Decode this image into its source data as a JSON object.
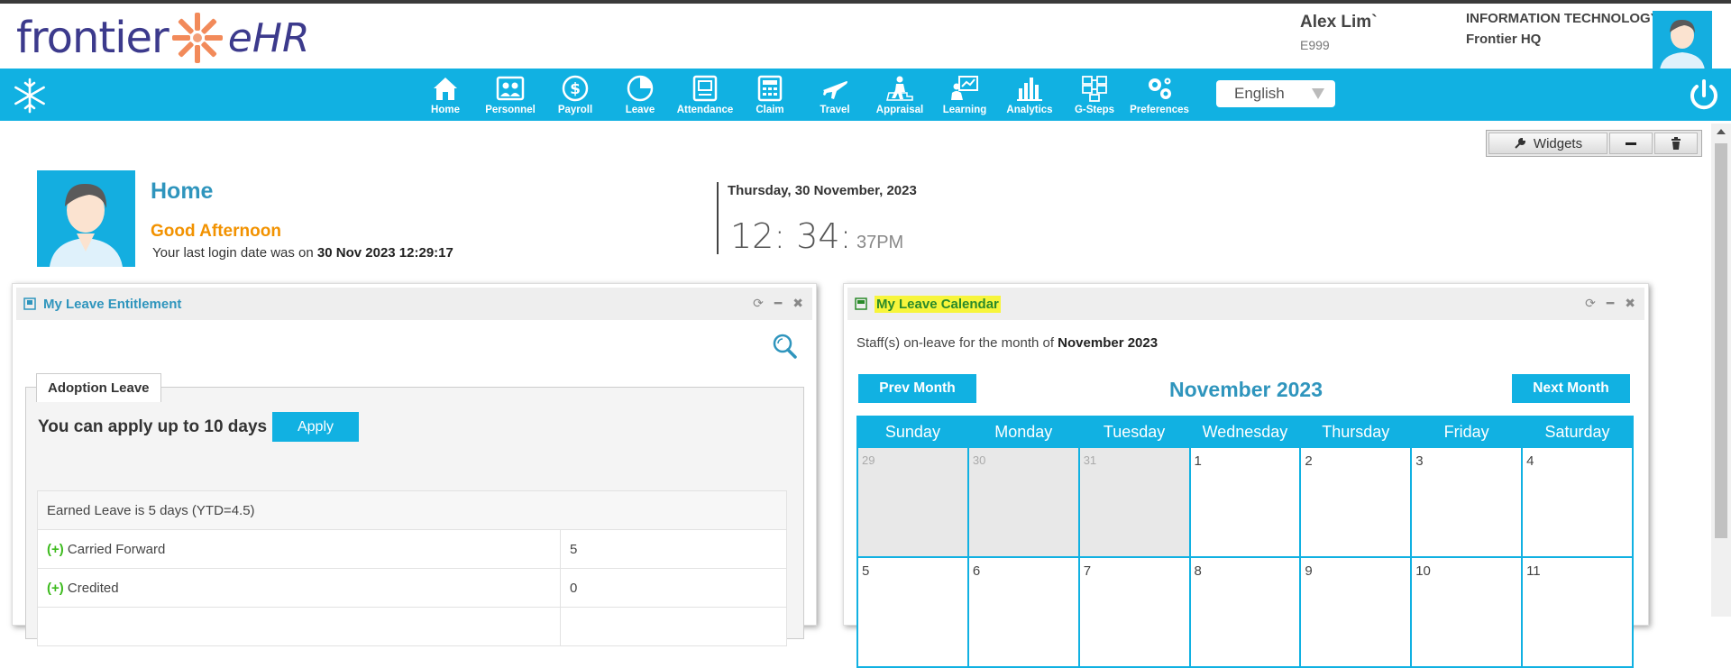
{
  "app": {
    "brand_main": "frontier",
    "brand_suffix": "eHR"
  },
  "user": {
    "name": "Alex Lim`",
    "id": "E999",
    "department": "INFORMATION TECHNOLOGY",
    "location": "Frontier HQ"
  },
  "nav": {
    "items": [
      {
        "label": "Home",
        "icon": "home-icon"
      },
      {
        "label": "Personnel",
        "icon": "personnel-icon"
      },
      {
        "label": "Payroll",
        "icon": "payroll-icon"
      },
      {
        "label": "Leave",
        "icon": "leave-icon"
      },
      {
        "label": "Attendance",
        "icon": "attendance-icon"
      },
      {
        "label": "Claim",
        "icon": "claim-icon"
      },
      {
        "label": "Travel",
        "icon": "travel-icon"
      },
      {
        "label": "Appraisal",
        "icon": "appraisal-icon"
      },
      {
        "label": "Learning",
        "icon": "learning-icon"
      },
      {
        "label": "Analytics",
        "icon": "analytics-icon"
      },
      {
        "label": "G-Steps",
        "icon": "gsteps-icon"
      },
      {
        "label": "Preferences",
        "icon": "preferences-icon"
      }
    ],
    "language": "English"
  },
  "toolbar": {
    "widgets_label": "Widgets"
  },
  "home": {
    "title": "Home",
    "greeting": "Good Afternoon",
    "last_login_prefix": "Your last login date was on ",
    "last_login_value": "30 Nov 2023 12:29:17",
    "date": "Thursday, 30 November, 2023",
    "time_hm": "12: 34:",
    "time_s": " 37PM"
  },
  "entitlement": {
    "title": "My Leave Entitlement",
    "tab": "Adoption Leave",
    "apply_text": "You can apply up to 10 days",
    "apply_button": "Apply",
    "rows": [
      {
        "label": "Earned Leave is 5 days (YTD=4.5)",
        "prefix": "",
        "value": ""
      },
      {
        "label": "Carried Forward",
        "prefix": "(+)",
        "value": "5"
      },
      {
        "label": "Credited",
        "prefix": "(+)",
        "value": "0"
      }
    ]
  },
  "calendar": {
    "title": "My Leave Calendar",
    "subtitle_prefix": "Staff(s) on-leave for the month of ",
    "subtitle_month": "November 2023",
    "prev_button": "Prev Month",
    "next_button": "Next Month",
    "month_label": "November 2023",
    "weekdays": [
      "Sunday",
      "Monday",
      "Tuesday",
      "Wednesday",
      "Thursday",
      "Friday",
      "Saturday"
    ],
    "weeks": [
      [
        {
          "d": "29",
          "prev": true
        },
        {
          "d": "30",
          "prev": true
        },
        {
          "d": "31",
          "prev": true
        },
        {
          "d": "1"
        },
        {
          "d": "2"
        },
        {
          "d": "3"
        },
        {
          "d": "4"
        }
      ],
      [
        {
          "d": "5"
        },
        {
          "d": "6"
        },
        {
          "d": "7"
        },
        {
          "d": "8"
        },
        {
          "d": "9"
        },
        {
          "d": "10"
        },
        {
          "d": "11"
        }
      ]
    ]
  },
  "colors": {
    "brand_blue": "#11b1e2",
    "title_blue": "#2f95bd",
    "greeting_orange": "#f29200",
    "logo_purple": "#3c3a8c",
    "highlight_yellow": "#f7f53b"
  }
}
